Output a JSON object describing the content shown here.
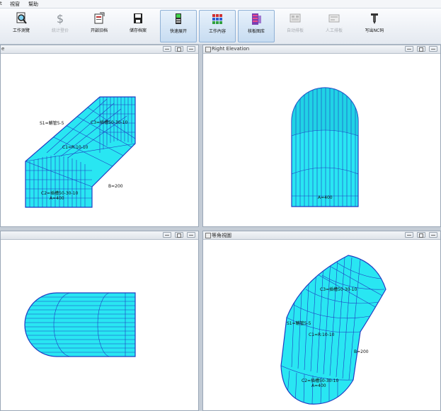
{
  "menu": [
    "視窗",
    "幫助"
  ],
  "toolbar": [
    {
      "label": "工作測覽",
      "icon": "search-doc-icon",
      "state": "normal"
    },
    {
      "label": "統计登价",
      "icon": "dollar-icon",
      "state": "disabled"
    },
    {
      "label": "开啟旧档",
      "icon": "open-file-icon",
      "state": "normal"
    },
    {
      "label": "储存档案",
      "icon": "save-icon",
      "state": "normal"
    },
    {
      "label": "快速展开",
      "icon": "quick-unfold-icon",
      "state": "active"
    },
    {
      "label": "工作內容",
      "icon": "grid-content-icon",
      "state": "active"
    },
    {
      "label": "核板图库",
      "icon": "library-icon",
      "state": "active"
    },
    {
      "label": "自动排板",
      "icon": "auto-nest-icon",
      "state": "disabled"
    },
    {
      "label": "人工排板",
      "icon": "manual-nest-icon",
      "state": "disabled"
    },
    {
      "label": "写出NC码",
      "icon": "nc-code-icon",
      "state": "normal"
    }
  ],
  "panes": {
    "top_left": {
      "title": "e"
    },
    "top_right": {
      "title": "Right Elevation"
    },
    "bottom_left": {
      "title": ""
    },
    "bottom_right": {
      "title": "等角視圖"
    }
  },
  "labels": {
    "front": {
      "s1": "S1=輔管5-5",
      "c3": "C3=插槽50-30-10",
      "c1": "C1=R:10-10",
      "c2": "C2=插槽50-30-10",
      "a": "A=400",
      "b": "B=200"
    },
    "right": {
      "a": "A=400"
    },
    "iso": {
      "c3": "C3=插槽50-30-10",
      "s1": "S1=輔管5-5",
      "c1": "C1=R:10-10",
      "b": "B=200",
      "c2": "C2=插槽50-30-10",
      "a": "A=400"
    }
  },
  "colors": {
    "fill": "#29e6f2",
    "fill_dark": "#1ac6dc",
    "edge": "#1f3cc2"
  }
}
